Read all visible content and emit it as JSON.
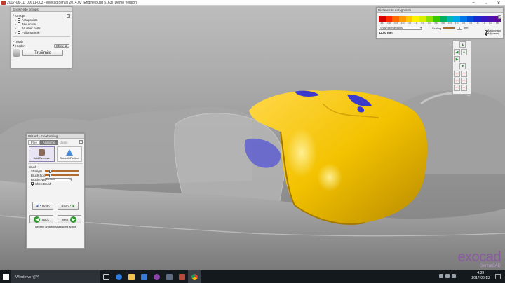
{
  "window": {
    "title": "2017-06-11_00011-003 - exocad dental 2014.02 [Engine build 5163] [Demo Version]",
    "minimize": "–",
    "maximize": "□",
    "close": "✕"
  },
  "groups_panel": {
    "title": "Show/Hide groups",
    "groups_label": "Groups",
    "items": [
      {
        "label": "Antagonists",
        "checked": false
      },
      {
        "label": "Jaw scans",
        "checked": false
      },
      {
        "label": "All other parts",
        "checked": false
      },
      {
        "label": "Full anatomic",
        "checked": false
      }
    ],
    "tooth_label": "Tooth",
    "hidden_label": "Hidden",
    "show_all": "Show all",
    "trusmile": "TruSmile",
    "help": "?"
  },
  "distance_panel": {
    "title": "Distance to Antagonists",
    "scale_values": [
      "-0.41",
      "-0.31",
      "-0.21",
      "-0.11",
      "0.00",
      "0.11",
      "0.21",
      "0.31",
      "0.41",
      "0.51",
      "0.61",
      "0.71",
      "0.81",
      "0.91",
      "1.01",
      "1.11",
      "1.21",
      "1.50"
    ],
    "scale_colors": [
      "#d40000",
      "#ff2a00",
      "#ff6a00",
      "#ff9a00",
      "#ffc800",
      "#fff000",
      "#d8f000",
      "#8ee000",
      "#3ac800",
      "#00b060",
      "#00b8b0",
      "#00a8e8",
      "#0078e8",
      "#0050d8",
      "#1a2ad0",
      "#3418c0",
      "#4a10b0",
      "#5a08a0"
    ],
    "intersections_select": "Show intersections",
    "scaling_label": "Scaling",
    "scaling_value": "1",
    "scaling_unit": "mm",
    "distance_value": "12.50 mm",
    "antagonists_label": "Antagonists",
    "adjacents_label": "Adjacents",
    "help": "?"
  },
  "wizard": {
    "title": "Wizard - Freeforming",
    "tabs": [
      "Free",
      "Anatomic",
      "Justic"
    ],
    "tool_add_remove": "Add/Remove",
    "tool_smooth": "Smooth/Flatten",
    "brush_section": "Brush",
    "strength_label": "Strength",
    "brush_size_label": "Brush Size",
    "brush_type_label": "Brush type",
    "brush_type_value": "Default",
    "show_brush_label": "Show Brush",
    "undo": "Undo",
    "redo": "Redo",
    "back": "Back",
    "next": "Next",
    "status": "Next for antagonist/adjacent adapt",
    "help": "?",
    "strength_fraction": 0.12,
    "brush_size_fraction": 0.12
  },
  "brand": {
    "logo_main": "exocad",
    "logo_sub": "DentalCAD",
    "purple": "#8a5aa0"
  },
  "taskbar": {
    "search_placeholder": "Windows 검색",
    "time": "4:39",
    "date": "2017-06-13",
    "icons": [
      "task-view-icon",
      "edge-icon",
      "file-explorer-icon",
      "store-icon",
      "app1-icon",
      "app2-icon",
      "exocad-icon",
      "chrome-icon"
    ]
  },
  "colors": {
    "crown_yellow": "#f3c200",
    "crown_dark": "#c99a00",
    "contact_blue": "#3a3acd",
    "gingiva": "#9d9d9d"
  }
}
